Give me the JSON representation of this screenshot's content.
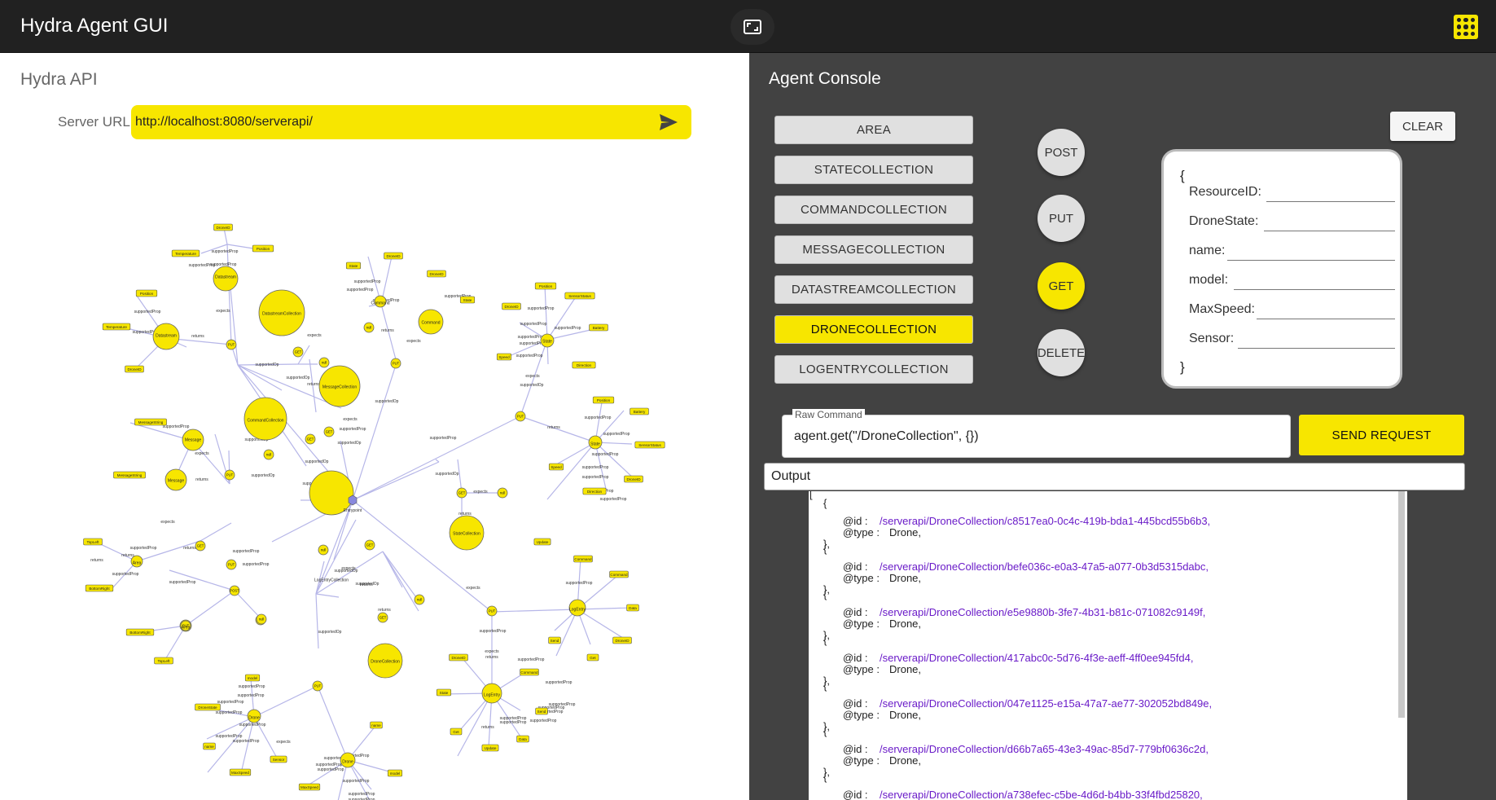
{
  "app": {
    "title": "Hydra Agent GUI"
  },
  "left": {
    "title": "Hydra API",
    "server_label": "Server URL:",
    "server_url": "http://localhost:8080/serverapi/"
  },
  "graph": {
    "node_labels": {
      "entrypoint": "Entrypoint",
      "datastream": "Datastream",
      "datastream_collection": "DatastreamCollection",
      "message_collection": "MessageCollection",
      "command_collection": "CommandCollection",
      "command": "Command",
      "message": "Message",
      "area": "Area",
      "state": "State",
      "state_collection": "StateCollection",
      "log_entry_collection": "LogEntryCollection",
      "log_entry": "LogEntry",
      "drone_collection": "DroneCollection",
      "drone": "Drone"
    },
    "op_labels": {
      "get": "GET",
      "put": "PUT",
      "post": "POST",
      "null": "null"
    },
    "edge_labels": {
      "supported_prop": "supportedProp",
      "supported_op": "supportedOp",
      "expects": "expects",
      "returns": "returns"
    },
    "prop_labels": {
      "drone_id": "DroneID",
      "position": "Position",
      "temperature": "Temperature",
      "state": "State",
      "sensor_status": "SensorStatus",
      "battery": "Battery",
      "speed": "Speed",
      "direction": "Direction",
      "message_string": "MessageString",
      "top_left": "TopLeft",
      "bottom_right": "BottomRight",
      "update": "Update",
      "command": "Command",
      "data": "Data",
      "send": "Send",
      "get": "Get",
      "model": "model",
      "name": "name",
      "drone_state": "DroneState",
      "max_speed": "MaxSpeed",
      "sensor": "Sensor"
    }
  },
  "console": {
    "title": "Agent Console",
    "collections": [
      "AREA",
      "STATECOLLECTION",
      "COMMANDCOLLECTION",
      "MESSAGECOLLECTION",
      "DATASTREAMCOLLECTION",
      "DRONECOLLECTION",
      "LOGENTRYCOLLECTION"
    ],
    "active_collection": "DRONECOLLECTION",
    "methods": [
      "POST",
      "PUT",
      "GET",
      "DELETE"
    ],
    "active_method": "GET",
    "clear_label": "CLEAR",
    "properties": {
      "open": "{",
      "close": "}",
      "fields": [
        "ResourceID:",
        "DroneState:",
        "name:",
        "model:",
        "MaxSpeed:",
        "Sensor:"
      ]
    },
    "raw_label": "Raw Command",
    "raw_value": "agent.get(\"/DroneCollection\", {})",
    "send_label": "SEND REQUEST",
    "output_label": "Output",
    "output": {
      "open_bracket": "[",
      "obj_open": "{",
      "obj_close": "},",
      "id_key": "@id :",
      "type_key": "@type :",
      "type_value": "Drone,",
      "ids": [
        "/serverapi/DroneCollection/c8517ea0-0c4c-419b-bda1-445bcd55b6b3,",
        "/serverapi/DroneCollection/befe036c-e0a3-47a5-a077-0b3d5315dabc,",
        "/serverapi/DroneCollection/e5e9880b-3fe7-4b31-b81c-071082c9149f,",
        "/serverapi/DroneCollection/417abc0c-5d76-4f3e-aeff-4ff0ee945fd4,",
        "/serverapi/DroneCollection/047e1125-e15a-47a7-ae77-302052bd849e,",
        "/serverapi/DroneCollection/d66b7a65-43e3-49ac-85d7-779bf0636c2d,",
        "/serverapi/DroneCollection/a738efec-c5be-4d6d-b4bb-33f4fbd25820,"
      ]
    }
  }
}
